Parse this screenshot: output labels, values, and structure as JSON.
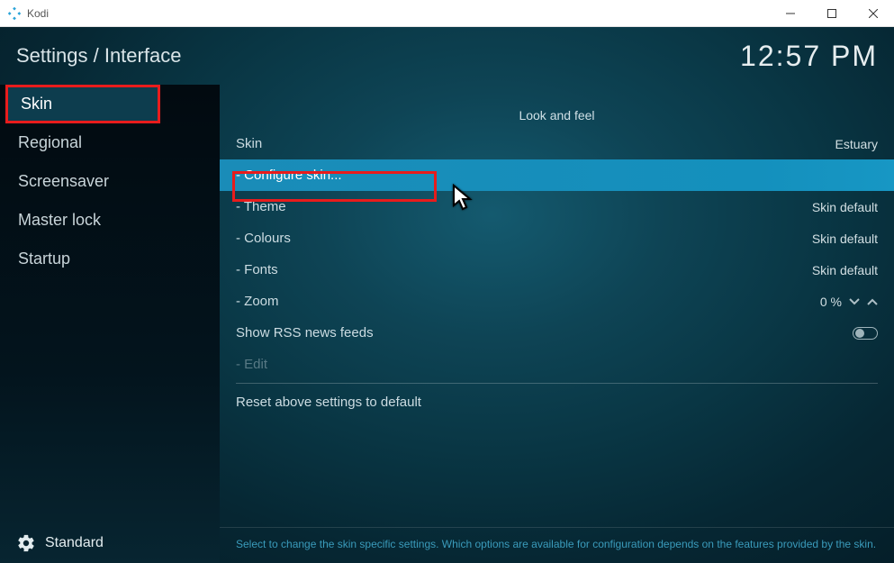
{
  "window": {
    "app_name": "Kodi"
  },
  "header": {
    "breadcrumb": "Settings / Interface",
    "clock": "12:57 PM"
  },
  "sidebar": {
    "items": [
      {
        "label": "Skin",
        "active": true
      },
      {
        "label": "Regional",
        "active": false
      },
      {
        "label": "Screensaver",
        "active": false
      },
      {
        "label": "Master lock",
        "active": false
      },
      {
        "label": "Startup",
        "active": false
      }
    ],
    "level_label": "Standard"
  },
  "main": {
    "section_title": "Look and feel",
    "rows": {
      "skin": {
        "label": "Skin",
        "value": "Estuary"
      },
      "configure_skin": {
        "label": "- Configure skin..."
      },
      "theme": {
        "label": "- Theme",
        "value": "Skin default"
      },
      "colours": {
        "label": "- Colours",
        "value": "Skin default"
      },
      "fonts": {
        "label": "- Fonts",
        "value": "Skin default"
      },
      "zoom": {
        "label": "- Zoom",
        "value": "0 %"
      },
      "rss": {
        "label": "Show RSS news feeds",
        "toggle": false
      },
      "edit": {
        "label": "- Edit"
      },
      "reset": {
        "label": "Reset above settings to default"
      }
    },
    "help_text": "Select to change the skin specific settings. Which options are available for configuration depends on the features provided by the skin."
  }
}
